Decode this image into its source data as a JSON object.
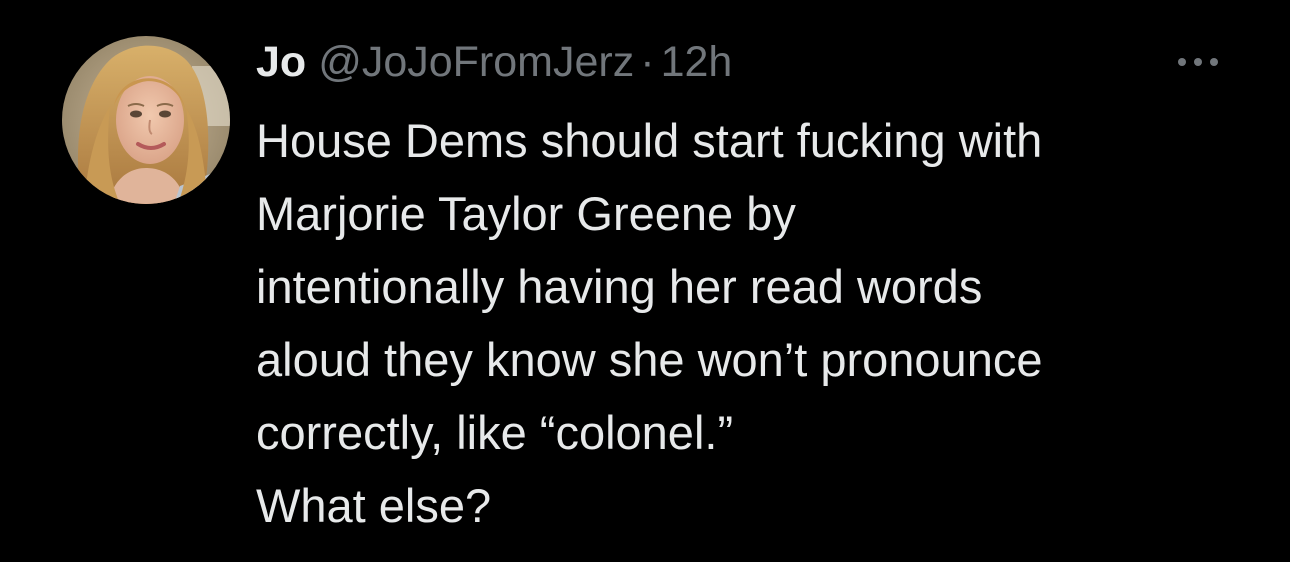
{
  "tweet": {
    "author": {
      "display_name": "Jo",
      "handle": "@JoJoFromJerz",
      "avatar_icon": "profile-photo-avatar"
    },
    "separator": "·",
    "timestamp": "12h",
    "more_icon": "more-options-icon",
    "text_lines": [
      "House Dems should start fucking with",
      "Marjorie Taylor Greene by",
      "intentionally having her read words",
      "aloud they know she won’t pronounce",
      "correctly, like “colonel.”",
      "What else?"
    ]
  },
  "colors": {
    "background": "#000000",
    "primary_text": "#e7e9ea",
    "secondary_text": "#71767b"
  }
}
